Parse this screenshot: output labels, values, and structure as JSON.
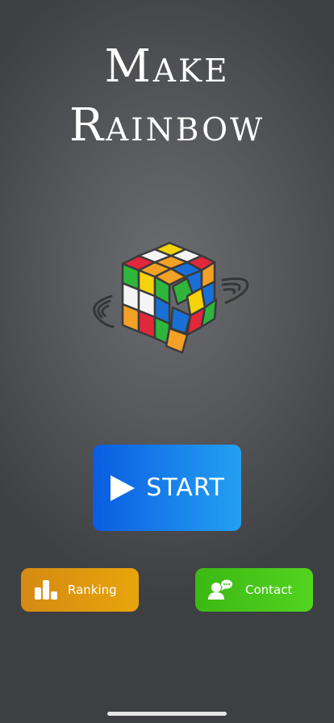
{
  "app": {
    "title_line1": "Make",
    "title_line2": "Rainbow"
  },
  "hero": {
    "image": "rubiks-cube-icon",
    "colors": {
      "red": "#e0283a",
      "green": "#2fb53b",
      "blue": "#1a6fd6",
      "yellow": "#f4d20c",
      "orange": "#f3a126",
      "white": "#f4f4f4"
    }
  },
  "buttons": {
    "start_label": "START",
    "start_icon": "play-icon",
    "ranking_label": "Ranking",
    "ranking_icon": "bar-chart-icon",
    "contact_label": "Contact",
    "contact_icon": "chat-person-icon"
  },
  "colors": {
    "start": "#0a5de0",
    "ranking": "#e39a10",
    "contact": "#45c41a",
    "background": "#58595c"
  }
}
